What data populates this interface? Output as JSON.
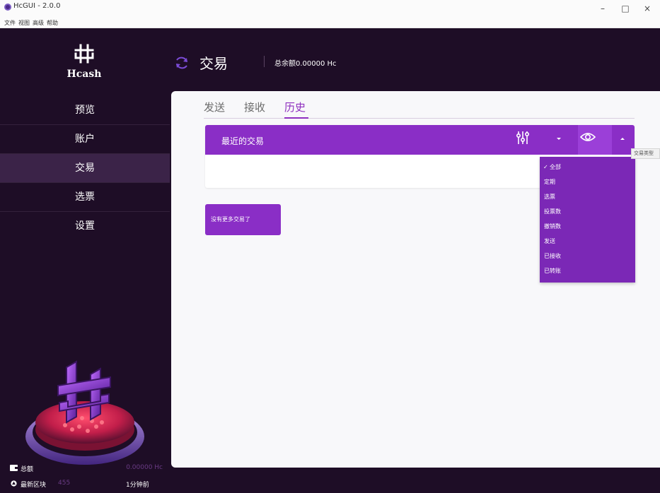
{
  "window": {
    "title": "HcGUI - 2.0.0",
    "controls": {
      "minimize": "–",
      "maximize": "□",
      "close": "×"
    }
  },
  "menubar": {
    "items": [
      "文件",
      "视图",
      "高级",
      "帮助"
    ]
  },
  "sidebar": {
    "logo_text": "Hcash",
    "items": [
      {
        "label": "预览",
        "active": false
      },
      {
        "label": "账户",
        "active": false
      },
      {
        "label": "交易",
        "active": true
      },
      {
        "label": "选票",
        "active": false
      },
      {
        "label": "设置",
        "active": false
      }
    ],
    "footer": {
      "balance_label": "总额",
      "balance_value": "0.00000 Hc",
      "block_label": "最新区块",
      "block_height": "455",
      "block_age": "1分钟前"
    }
  },
  "header": {
    "title": "交易",
    "balance": "总余额0.00000 Hc"
  },
  "tabs": [
    {
      "label": "发送",
      "active": false
    },
    {
      "label": "接收",
      "active": false
    },
    {
      "label": "历史",
      "active": true
    }
  ],
  "panel": {
    "title": "最近的交易",
    "no_more_label": "没有更多交易了"
  },
  "filter_menu": {
    "check_mark": "✓",
    "options": [
      "全部",
      "定期",
      "选票",
      "投票数",
      "撤销数",
      "发送",
      "已接收",
      "已转账"
    ],
    "selected": "全部"
  },
  "tooltip": {
    "text": "交易类型"
  },
  "colors": {
    "sidebar_bg": "#1e0d26",
    "active_nav": "#3b2348",
    "accent_purple": "#8a2ec6",
    "dropdown_bg": "#7b28b6",
    "footer_value": "#6a3b85"
  },
  "icons": {
    "refresh": "refresh-icon",
    "filter": "sliders-icon",
    "eye": "eye-icon",
    "wallet": "wallet-icon",
    "block": "block-icon"
  }
}
